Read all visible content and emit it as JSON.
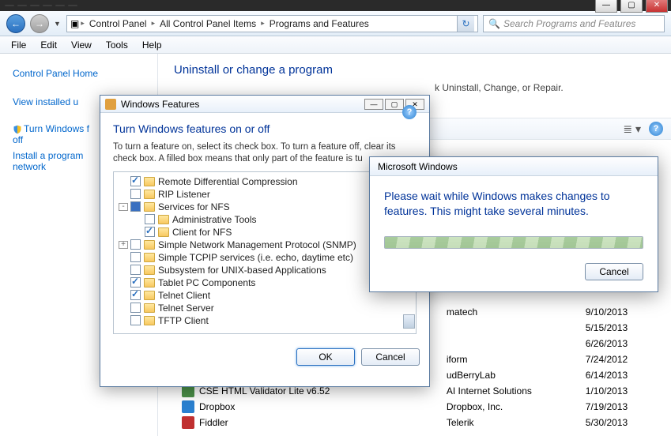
{
  "window_controls": {
    "min": "—",
    "max": "▢",
    "close": "✕"
  },
  "tabs": [
    "",
    "",
    "",
    "",
    "",
    ""
  ],
  "nav": {
    "back": "←",
    "fwd": "→"
  },
  "breadcrumb": {
    "icon": "▣",
    "segs": [
      "Control Panel",
      "All Control Panel Items",
      "Programs and Features"
    ]
  },
  "search_placeholder": "Search Programs and Features",
  "menubar": [
    "File",
    "Edit",
    "View",
    "Tools",
    "Help"
  ],
  "sidebar": {
    "home": "Control Panel Home",
    "links": [
      "View installed u",
      "Turn Windows f\noff",
      "Install a program\nnetwork"
    ]
  },
  "content": {
    "title": "Uninstall or change a program",
    "hint_tail": "k Uninstall, Change, or Repair."
  },
  "toolbarview": {
    "view": "≣ ▾"
  },
  "programs_tail": [
    {
      "name": "",
      "pub": "",
      "date": ""
    },
    {
      "name": "",
      "pub": "matech",
      "date": "9/10/2013"
    },
    {
      "name": "",
      "pub": "",
      "date": "5/15/2013"
    },
    {
      "name": "",
      "pub": "",
      "date": "6/26/2013"
    },
    {
      "name": "",
      "pub": "iform",
      "date": "7/24/2012"
    },
    {
      "name": "",
      "pub": "udBerryLab",
      "date": "6/14/2013"
    },
    {
      "name": "CSE HTML Validator Lite v6.52",
      "pub": "AI Internet Solutions",
      "date": "1/10/2013"
    },
    {
      "name": "Dropbox",
      "pub": "Dropbox, Inc.",
      "date": "7/19/2013"
    },
    {
      "name": "Fiddler",
      "pub": "Telerik",
      "date": "5/30/2013"
    }
  ],
  "features_dialog": {
    "title": "Windows Features",
    "heading": "Turn Windows features on or off",
    "desc": "To turn a feature on, select its check box. To turn a feature off, clear its check box. A filled box means that only part of the feature is tu",
    "items": [
      {
        "lvl": 0,
        "exp": "",
        "check": "checked",
        "label": "Remote Differential Compression"
      },
      {
        "lvl": 0,
        "exp": "",
        "check": "",
        "label": "RIP Listener"
      },
      {
        "lvl": 0,
        "exp": "-",
        "check": "filled",
        "label": "Services for NFS"
      },
      {
        "lvl": 1,
        "exp": "",
        "check": "",
        "label": "Administrative Tools"
      },
      {
        "lvl": 1,
        "exp": "",
        "check": "checked",
        "label": "Client for NFS"
      },
      {
        "lvl": 0,
        "exp": "+",
        "check": "",
        "label": "Simple Network Management Protocol (SNMP)"
      },
      {
        "lvl": 0,
        "exp": "",
        "check": "",
        "label": "Simple TCPIP services (i.e. echo, daytime etc)"
      },
      {
        "lvl": 0,
        "exp": "",
        "check": "",
        "label": "Subsystem for UNIX-based Applications"
      },
      {
        "lvl": 0,
        "exp": "",
        "check": "checked",
        "label": "Tablet PC Components"
      },
      {
        "lvl": 0,
        "exp": "",
        "check": "checked",
        "label": "Telnet Client"
      },
      {
        "lvl": 0,
        "exp": "",
        "check": "",
        "label": "Telnet Server"
      },
      {
        "lvl": 0,
        "exp": "",
        "check": "",
        "label": "TFTP Client"
      }
    ],
    "ok": "OK",
    "cancel": "Cancel"
  },
  "progress_dialog": {
    "title": "Microsoft Windows",
    "msg": "Please wait while Windows makes changes to features. This might take several minutes.",
    "cancel": "Cancel"
  }
}
